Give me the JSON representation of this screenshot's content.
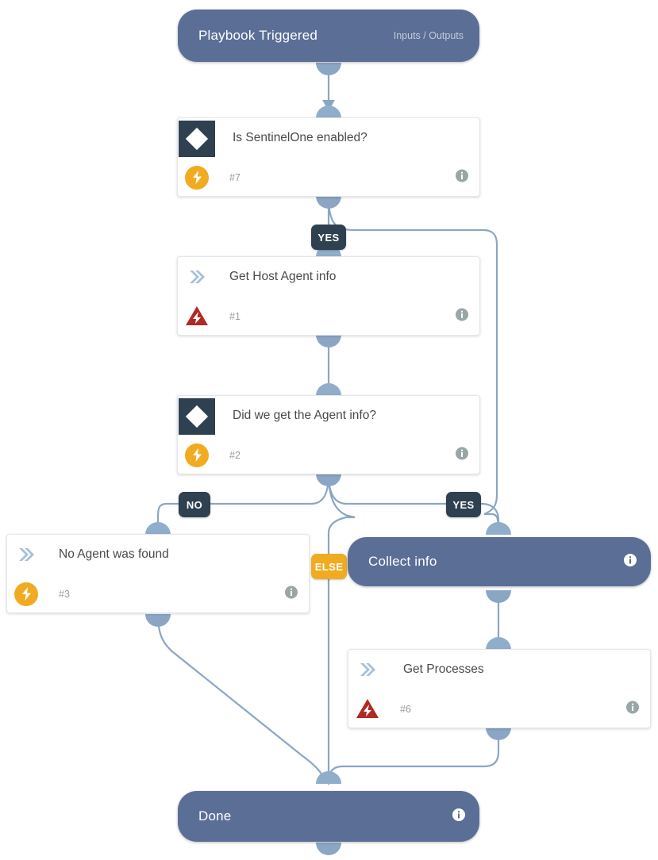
{
  "diagram": {
    "type": "playbook-flow",
    "background": "#ffffff",
    "accent_pill": "#5b6e96",
    "accent_dark": "#2f4050",
    "accent_amber": "#f0ab21",
    "accent_red": "#b02a23",
    "edge_color": "#8ba6c4"
  },
  "nodes": {
    "trigger": {
      "title": "Playbook Triggered",
      "subtitle": "Inputs / Outputs",
      "shape": "pill"
    },
    "cond_sentinelone": {
      "title": "Is SentinelOne enabled?",
      "number": "#7",
      "icon": "diamond-icon",
      "badge": "bolt-circle-icon",
      "shape": "card"
    },
    "step_host_agent": {
      "title": "Get  Host Agent info",
      "number": "#1",
      "icon": "chevron-right-icon",
      "badge": "warning-bolt-icon",
      "shape": "card"
    },
    "cond_agent_info": {
      "title": "Did we get the Agent info?",
      "number": "#2",
      "icon": "diamond-icon",
      "badge": "bolt-circle-icon",
      "shape": "card"
    },
    "step_no_agent": {
      "title": "No Agent was found",
      "number": "#3",
      "icon": "chevron-right-icon",
      "badge": "bolt-circle-icon",
      "shape": "card"
    },
    "group_collect": {
      "title": "Collect info",
      "shape": "pill"
    },
    "step_get_processes": {
      "title": "Get Processes",
      "number": "#6",
      "icon": "chevron-right-icon",
      "badge": "warning-bolt-icon",
      "shape": "card"
    },
    "done": {
      "title": "Done",
      "shape": "pill"
    }
  },
  "branch_labels": {
    "yes_sentinelone": "YES",
    "no_agent": "NO",
    "yes_agent": "YES",
    "else_agent": "ELSE"
  }
}
